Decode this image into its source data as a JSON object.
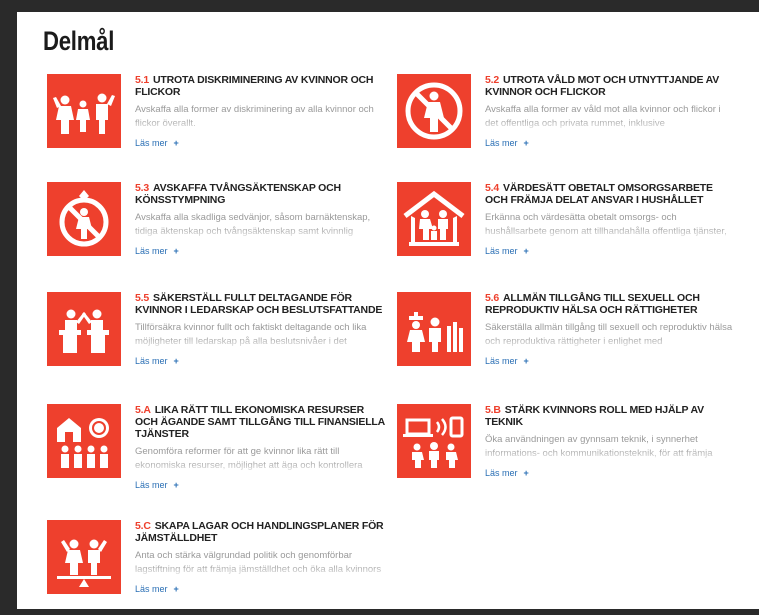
{
  "page": {
    "title": "Delmål"
  },
  "targets": [
    {
      "number": "5.1",
      "title": "UTROTA DISKRIMINERING AV KVINNOR OCH FLICKOR",
      "description": "Avskaffa alla former av diskriminering av alla kvinnor och flickor överallt.",
      "link": "Läs mer",
      "plus": "+",
      "icon": "women-and-girls-icon"
    },
    {
      "number": "5.2",
      "title": "UTROTA VÅLD MOT OCH UTNYTTJANDE AV KVINNOR OCH FLICKOR",
      "description": "Avskaffa alla former av våld mot alla kvinnor och flickor i det offentliga och privata rummet, inklusive människohandel,",
      "link": "Läs mer",
      "plus": "+",
      "icon": "no-violence-icon"
    },
    {
      "number": "5.3",
      "title": "AVSKAFFA TVÅNGSÄKTENSKAP OCH KÖNSSTYMPNING",
      "description": "Avskaffa alla skadliga sedvänjor, såsom barnäktenskap, tidiga äktenskap och tvångsäktenskap samt kvinnlig",
      "link": "Läs mer",
      "plus": "+",
      "icon": "no-child-marriage-icon"
    },
    {
      "number": "5.4",
      "title": "VÄRDESÄTT OBETALT OMSORGSARBETE OCH FRÄMJA DELAT ANSVAR I HUSHÅLLET",
      "description": "Erkänna och värdesätta obetalt omsorgs- och hushållsarbete genom att tillhandahålla offentliga tjänster,",
      "link": "Läs mer",
      "plus": "+",
      "icon": "family-house-icon"
    },
    {
      "number": "5.5",
      "title": "SÄKERSTÄLL FULLT DELTAGANDE FÖR KVINNOR I LEDARSKAP OCH BESLUTSFATTANDE",
      "description": "Tillförsäkra kvinnor fullt och faktiskt deltagande och lika möjligheter till ledarskap på alla beslutsnivåer i det",
      "link": "Läs mer",
      "plus": "+",
      "icon": "leadership-podium-icon"
    },
    {
      "number": "5.6",
      "title": "ALLMÄN TILLGÅNG TILL SEXUELL OCH REPRODUKTIV HÄLSA OCH RÄTTIGHETER",
      "description": "Säkerställa allmän tillgång till sexuell och reproduktiv hälsa och reproduktiva rättigheter i enlighet med",
      "link": "Läs mer",
      "plus": "+",
      "icon": "health-care-icon"
    },
    {
      "number": "5.A",
      "title": "LIKA RÄTT TILL EKONOMISKA RESURSER OCH ÄGANDE SAMT TILLGÅNG TILL FINANSIELLA TJÄNSTER",
      "description": "Genomföra reformer för att ge kvinnor lika rätt till ekonomiska resurser, möjlighet att äga och kontrollera mark",
      "link": "Läs mer",
      "plus": "+",
      "icon": "economic-resources-icon"
    },
    {
      "number": "5.B",
      "title": "STÄRK KVINNORS ROLL MED HJÄLP AV TEKNIK",
      "description": "Öka användningen av gynnsam teknik, i synnerhet informations- och kommunikationsteknik, för att främja",
      "link": "Läs mer",
      "plus": "+",
      "icon": "technology-icon"
    },
    {
      "number": "5.C",
      "title": "SKAPA LAGAR OCH HANDLINGSPLANER FÖR JÄMSTÄLLDHET",
      "description": "Anta och stärka välgrundad politik och genomförbar lagstiftning för att främja jämställdhet och öka alla kvinnors",
      "link": "Läs mer",
      "plus": "+",
      "icon": "equality-scale-icon"
    }
  ],
  "colors": {
    "accent": "#ee402d",
    "link": "#2a6fb5",
    "background": "#2a2a2a"
  }
}
